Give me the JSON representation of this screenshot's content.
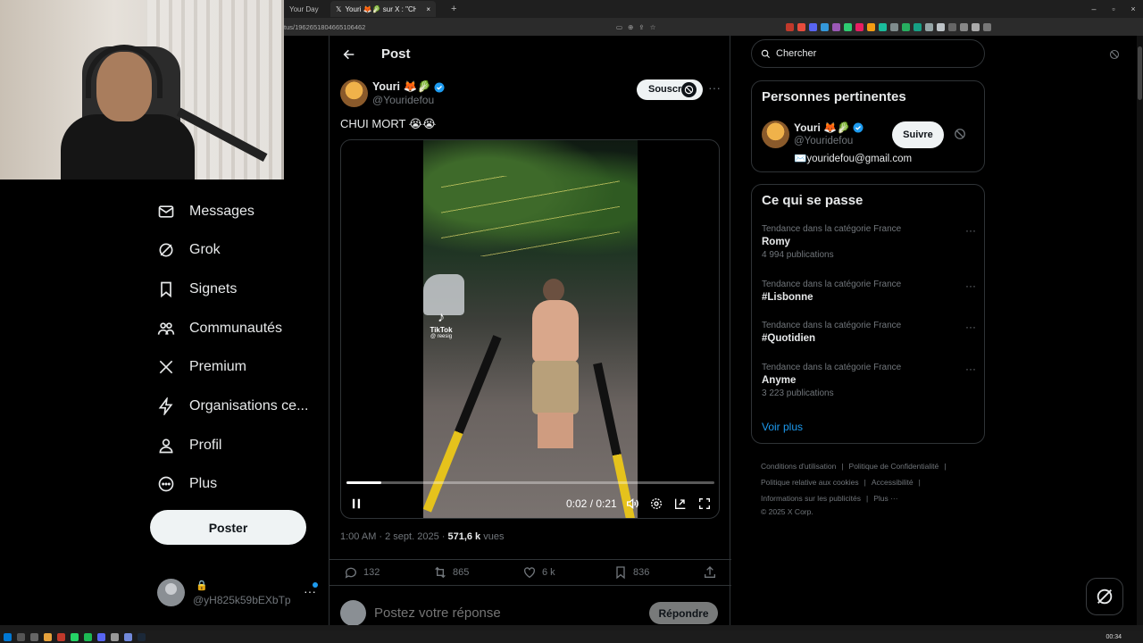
{
  "browser": {
    "tab_inactive_label": "Your Day",
    "tab_active_label": "Youri 🦊🥬 sur X : \"CHUI MO",
    "url": "tus/1962651804665106462"
  },
  "nav": {
    "items": [
      {
        "label": "Messages",
        "icon": "mail-icon"
      },
      {
        "label": "Grok",
        "icon": "grok-icon"
      },
      {
        "label": "Signets",
        "icon": "bookmark-icon"
      },
      {
        "label": "Communautés",
        "icon": "communities-icon"
      },
      {
        "label": "Premium",
        "icon": "x-logo-icon"
      },
      {
        "label": "Organisations ce...",
        "icon": "lightning-icon"
      },
      {
        "label": "Profil",
        "icon": "profile-icon"
      },
      {
        "label": "Plus",
        "icon": "more-circle-icon"
      }
    ],
    "post_button": "Poster",
    "account": {
      "handle": "@yH825k59bEXbTp",
      "lock": "🔒",
      "more": "···"
    }
  },
  "post": {
    "header_title": "Post",
    "author_name": "Youri 🦊🥬",
    "author_handle": "@Youridefou",
    "subscribe_label": "Souscr",
    "more": "···",
    "text": "CHUI MORT 😭😭",
    "video": {
      "watermark": "TikTok",
      "watermark_user": "@ reesig",
      "time": "0:02 / 0:21",
      "progress_fraction": 0.095
    },
    "meta": {
      "time": "1:00 AM · 2 sept. 2025 · ",
      "views": "571,6 k",
      "views_label": " vues"
    },
    "actions": {
      "replies": "132",
      "reposts": "865",
      "likes": "6 k",
      "bookmarks": "836"
    },
    "reply_placeholder": "Postez votre réponse",
    "reply_button": "Répondre"
  },
  "sidebar": {
    "search_placeholder": "Chercher",
    "relevant": {
      "title": "Personnes pertinentes",
      "name": "Youri 🦊🥬",
      "handle": "@Youridefou",
      "email": "✉️youridefou@gmail.com",
      "follow_label": "Suivre"
    },
    "trends": {
      "title": "Ce qui se passe",
      "items": [
        {
          "category": "Tendance dans la catégorie France",
          "name": "Romy",
          "count": "4 994 publications"
        },
        {
          "category": "Tendance dans la catégorie France",
          "name": "#Lisbonne",
          "count": ""
        },
        {
          "category": "Tendance dans la catégorie France",
          "name": "#Quotidien",
          "count": ""
        },
        {
          "category": "Tendance dans la catégorie France",
          "name": "Anyme",
          "count": "3 223 publications"
        }
      ],
      "see_more": "Voir plus"
    },
    "footer": {
      "links": [
        "Conditions d'utilisation",
        "Politique de Confidentialité",
        "Politique relative aux cookies",
        "Accessibilité",
        "Informations sur les publicités",
        "Plus ···"
      ],
      "copyright": "© 2025 X Corp."
    }
  },
  "taskbar": {
    "clock": "00:34"
  },
  "colors": {
    "accent": "#1d9bf0",
    "background": "#000000",
    "border": "#2f3336",
    "muted": "#71767b"
  }
}
